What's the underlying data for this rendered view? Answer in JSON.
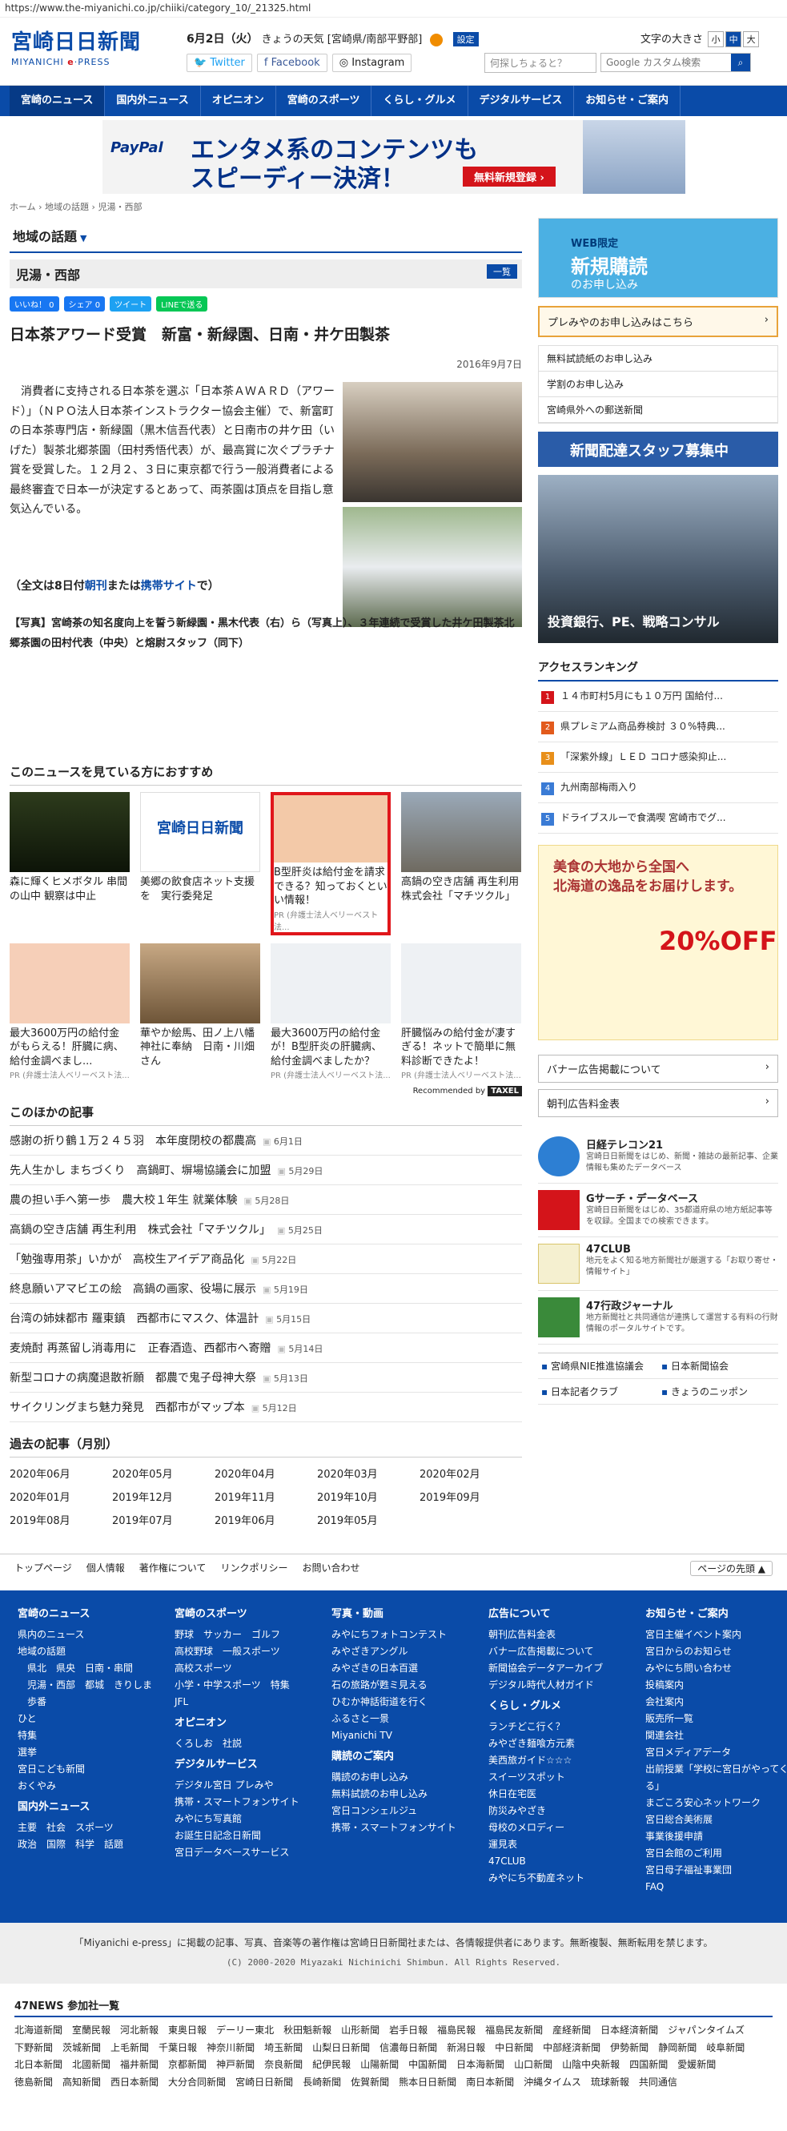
{
  "url": "https://www.the-miyanichi.co.jp/chiiki/category_10/_21325.html",
  "header": {
    "logo_jp": "宮崎日日新聞",
    "logo_en_pre": "MIYANICHI ",
    "logo_en_e": "e",
    "logo_en_post": "·PRESS",
    "date": "6月2日（火）",
    "weather": "きょうの天気 [宮崎県/南部平野部]",
    "settings": "設定",
    "twitter": "Twitter",
    "facebook": "Facebook",
    "instagram": "Instagram",
    "fontsize_label": "文字の大きさ",
    "fs_small": "小",
    "fs_mid": "中",
    "fs_large": "大",
    "question": "何探しちょると？",
    "search_placeholder": "Google カスタム検索"
  },
  "nav": [
    "宮崎のニュース",
    "国内外ニュース",
    "オピニオン",
    "宮崎のスポーツ",
    "くらし・グルメ",
    "デジタルサービス",
    "お知らせ・ご案内"
  ],
  "banner": {
    "brand": "PayPal",
    "line1": "エンタメ系のコンテンツも",
    "line2": "スピーディー決済！",
    "cta": "無料新規登録 ›"
  },
  "breadcrumb": "ホーム › 地域の話題 › 児湯・西部",
  "section_title": "地域の話題",
  "section_arrow": "▼",
  "category": "児湯・西部",
  "category_button": "一覧",
  "share": {
    "fb": "いいね！ 0",
    "fb2": "シェア 0",
    "tw": "ツイート",
    "line": "LINEで送る"
  },
  "article": {
    "headline": "日本茶アワード受賞　新富・新緑園、日南・井ケ田製茶",
    "date": "2016年9月7日",
    "body": "消費者に支持される日本茶を選ぶ「日本茶ＡＷＡＲＤ（アワード）」（ＮＰＯ法人日本茶インストラクター協会主催）で、新富町の日本茶専門店・新緑園（黒木信吾代表）と日南市の井ケ田（いげた）製茶北郷茶園（田村秀悟代表）が、最高賞に次ぐプラチナ賞を受賞した。１２月２、３日に東京都で行う一般消費者による最終審査で日本一が決定するとあって、両茶園は頂点を目指し意気込んでいる。",
    "zen_a": "（全文は8日付",
    "zen_b": "朝刊",
    "zen_c": "または",
    "zen_d": "携帯サイト",
    "zen_e": "で）",
    "caption": "【写真】宮崎茶の知名度向上を誓う新緑園・黒木代表（右）ら（写真上）、３年連続で受賞した井ケ田製茶北郷茶園の田村代表（中央）と熔尉スタッフ（同下）"
  },
  "recommend": {
    "title": "このニュースを見ている方におすすめ",
    "items": [
      {
        "title": "森に輝くヒメボタル 串間の山中 観察は中止",
        "pr": ""
      },
      {
        "title": "美郷の飲食店ネット支援を　実行委発足",
        "pr": ""
      },
      {
        "title": "B型肝炎は給付金を請求できる？知っておくといい情報！",
        "pr": "PR (弁護士法人ベリーベスト法..."
      },
      {
        "title": "高鍋の空き店舗 再生利用　株式会社「マチツクル」",
        "pr": ""
      },
      {
        "title": "最大3600万円の給付金がもらえる！肝臓に病、給付金調べまし...",
        "pr": "PR (弁護士法人ベリーベスト法..."
      },
      {
        "title": "華やか絵馬、田ノ上八幡神社に奉納　日南・川畑さん",
        "pr": ""
      },
      {
        "title": "最大3600万円の給付金が！B型肝炎の肝臓病、給付金調べましたか？",
        "pr": "PR (弁護士法人ベリーベスト法..."
      },
      {
        "title": "肝臓悩みの給付金が凄すぎる！ネットで簡単に無料診断できたよ！",
        "pr": "PR (弁護士法人ベリーベスト法..."
      }
    ],
    "by": "Recommended by",
    "by_brand": "TAXEL"
  },
  "others": {
    "title": "このほかの記事",
    "items": [
      {
        "t": "感謝の折り鶴１万２４５羽　本年度閉校の都農高",
        "d": "6月1日"
      },
      {
        "t": "先人生かし まちづくり　高鍋町、塀場協議会に加盟",
        "d": "5月29日"
      },
      {
        "t": "農の担い手へ第一歩　農大校１年生 就業体験",
        "d": "5月28日"
      },
      {
        "t": "高鍋の空き店舗 再生利用　株式会社「マチツクル」",
        "d": "5月25日"
      },
      {
        "t": "「勉強専用茶」いかが　高校生アイデア商品化",
        "d": "5月22日"
      },
      {
        "t": "終息願いアマビエの絵　高鍋の画家、役場に展示",
        "d": "5月19日"
      },
      {
        "t": "台湾の姉妹都市 羅東鎮　西都市にマスク、体温計",
        "d": "5月15日"
      },
      {
        "t": "麦焼酎 再蒸留し消毒用に　正春酒造、西都市へ寄贈",
        "d": "5月14日"
      },
      {
        "t": "新型コロナの病魔退散祈願　都農で鬼子母神大祭",
        "d": "5月13日"
      },
      {
        "t": "サイクリングまち魅力発見　西都市がマップ本",
        "d": "5月12日"
      }
    ]
  },
  "past": {
    "title": "過去の記事（月別）",
    "months": [
      "2020年06月",
      "2020年05月",
      "2020年04月",
      "2020年03月",
      "2020年02月",
      "2020年01月",
      "2019年12月",
      "2019年11月",
      "2019年10月",
      "2019年09月",
      "2019年08月",
      "2019年07月",
      "2019年06月",
      "2019年05月"
    ]
  },
  "side": {
    "web1": "WEB限定",
    "web2": "新規購読",
    "web3": "のお申し込み",
    "preva": "プレみやのお申し込みはこちら",
    "links": [
      "無料試読紙のお申し込み",
      "学割のお申し込み",
      "宮崎県外への郵送新聞"
    ],
    "staff": "新聞配達スタッフ募集中",
    "ad_text": "投資銀行、PE、戦略コンサル",
    "rank_title": "アクセスランキング",
    "rank": [
      "１４市町村5月にも１０万円 国給付...",
      "県プレミアム商品券検討 ３０%特典...",
      "「深紫外線」ＬＥＤ コロナ感染抑止...",
      "九州南部梅雨入り",
      "ドライブスルーで食満喫 宮崎市でグ..."
    ],
    "rank_colors": [
      "#d4141a",
      "#e25a1c",
      "#e88f1a",
      "#3a7bd5",
      "#3a7bd5"
    ],
    "hok1": "美食の大地から全国へ",
    "hok2": "北海道の逸品をお届けします。",
    "hok_off": "20%OFF",
    "ad_links": [
      "バナー広告掲載について",
      "朝刊広告料金表"
    ],
    "services": [
      {
        "n": "日経テレコン21",
        "d": "宮崎日日新聞をはじめ、新聞・雑誌の最新記事、企業情報も集めたデータベース"
      },
      {
        "n": "Gサーチ・データベース",
        "d": "宮崎日日新聞をはじめ、35都道府県の地方紙記事等を収録。全国までの検索できます。"
      },
      {
        "n": "47CLUB",
        "d": "地元をよく知る地方新聞社が厳選する「お取り寄せ・情報サイト」"
      },
      {
        "n": "47行政ジャーナル",
        "d": "地方新聞社と共同通信が連携して運営する有料の行財情報のポータルサイトです。"
      }
    ],
    "assoc": [
      "宮崎県NIE推進協議会",
      "日本新聞協会",
      "日本記者クラブ",
      "きょうのニッポン"
    ]
  },
  "footer": {
    "links": [
      "トップページ",
      "個人情報",
      "著作権について",
      "リンクポリシー",
      "お問い合わせ"
    ],
    "pagetop": "ページの先頭 ▲",
    "cols": [
      {
        "h": "宮崎のニュース",
        "items": [
          "県内のニュース",
          "地域の話題",
          "　県北　県央　日南・串間",
          "　児湯・西部　都城　きりしま",
          "　歩番",
          "ひと",
          "特集",
          "選挙",
          "宮日こども新聞",
          "おくやみ"
        ],
        "h2": "国内外ニュース",
        "items2": [
          "主要　社会　スポーツ",
          "政治　国際　科学　話題"
        ]
      },
      {
        "h": "宮崎のスポーツ",
        "items": [
          "野球　サッカー　ゴルフ",
          "高校野球　一般スポーツ",
          "高校スポーツ",
          "小学・中学スポーツ　特集",
          "JFL"
        ],
        "h2": "オピニオン",
        "items2": [
          "くろしお　社説"
        ],
        "h3": "デジタルサービス",
        "items3": [
          "デジタル宮日 プレみや",
          "携帯・スマートフォンサイト",
          "みやにち写真館",
          "お誕生日記念日新聞",
          "宮日データベースサービス"
        ]
      },
      {
        "h": "写真・動画",
        "items": [
          "みやにちフォトコンテスト",
          "みやざきアングル",
          "みやざきの日本百選",
          "石の旅路が甦ミ見える",
          "ひむか神話街道を行く",
          "ふるさと一景",
          "Miyanichi TV"
        ],
        "h2": "購読のご案内",
        "items2": [
          "購読のお申し込み",
          "無料試読のお申し込み",
          "宮日コンシェルジュ",
          "携帯・スマートフォンサイト"
        ]
      },
      {
        "h": "広告について",
        "items": [
          "朝刊広告料金表",
          "バナー広告掲載について",
          "新聞協会データアーカイブ",
          "デジタル時代人材ガイド"
        ],
        "h2": "くらし・グルメ",
        "items2": [
          "ランチどこ行く？",
          "みやざき麺喰方元素",
          "美西旅ガイド☆☆☆",
          "スイーツスポット",
          "休日在宅医",
          "防災みやざき",
          "母校のメロディー",
          "運見表",
          "47CLUB",
          "みやにち不動産ネット"
        ]
      },
      {
        "h": "お知らせ・ご案内",
        "items": [
          "宮日主催イベント案内",
          "宮日からのお知らせ",
          "みやにち問い合わせ",
          "投稿案内",
          "会社案内",
          "販売所一覧",
          "関連会社",
          "宮日メディアデータ",
          "出前授業「学校に宮日がやってくる」",
          "まごころ安心ネットワーク",
          "宮日総合美術展",
          "事業後援申請",
          "宮日会館のご利用",
          "宮日母子福祉事業団",
          "FAQ"
        ]
      }
    ]
  },
  "copyright": {
    "line1": "「Miyanichi e-press」に掲載の記事、写真、音楽等の著作権は宮崎日日新聞社または、各情報提供者にあります。無断複製、無断転用を禁じます。",
    "line2": "(C) 2000-2020 Miyazaki Nichinichi Shimbun. All Rights Reserved."
  },
  "news47": {
    "title": "47NEWS 参加社一覧",
    "papers": [
      "北海道新聞",
      "室蘭民報",
      "河北新報",
      "東奥日報",
      "デーリー東北",
      "秋田魁新報",
      "山形新聞",
      "岩手日報",
      "福島民報",
      "福島民友新聞",
      "産経新聞",
      "日本経済新聞",
      "ジャパンタイムズ",
      "下野新聞",
      "茨城新聞",
      "上毛新聞",
      "千葉日報",
      "神奈川新聞",
      "埼玉新聞",
      "山梨日日新聞",
      "信濃毎日新聞",
      "新潟日報",
      "中日新聞",
      "中部経済新聞",
      "伊勢新聞",
      "静岡新聞",
      "岐阜新聞",
      "北日本新聞",
      "北國新聞",
      "福井新聞",
      "京都新聞",
      "神戸新聞",
      "奈良新聞",
      "紀伊民報",
      "山陽新聞",
      "中国新聞",
      "日本海新聞",
      "山口新聞",
      "山陰中央新報",
      "四国新聞",
      "愛媛新聞",
      "徳島新聞",
      "高知新聞",
      "西日本新聞",
      "大分合同新聞",
      "宮崎日日新聞",
      "長崎新聞",
      "佐賀新聞",
      "熊本日日新聞",
      "南日本新聞",
      "沖縄タイムス",
      "琉球新報",
      "共同通信"
    ]
  }
}
